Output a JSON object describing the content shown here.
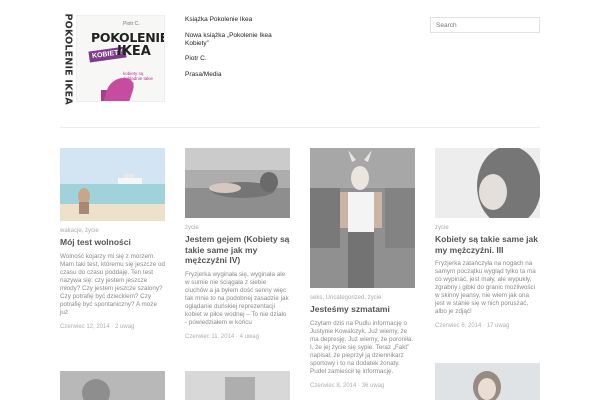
{
  "site": {
    "vertical_title": "POKOLENIE IKEA",
    "book": {
      "author": "Piotr C.",
      "title_line1": "POKOLENIE",
      "title_line2": "IKEA",
      "badge": "KOBIETY",
      "subtitle": "kobiety są dokładnie takie same"
    }
  },
  "nav": {
    "items": [
      "Książka Pokolenie Ikea",
      "Nowa książka „Pokolenie Ikea Kobiety”",
      "Piotr C.",
      "Prasa/Media"
    ]
  },
  "search": {
    "placeholder": "Search"
  },
  "posts": [
    {
      "category": "wakacje, życie",
      "title": "Mój test wolności",
      "excerpt": "Wolność kojarzy mi się z morzem. Mam taki test, któremu się jeszcze od czasu do czasu poddaję. Ten test nazywa się: czy jestem jeszcze młody? Czy jestem jeszcze szalony? Czy potrafię być dzieckiem? Czy potrafię być spontaniczny? A może już",
      "meta": "Czerwiec 12, 2014 · 2 uwag"
    },
    {
      "category": "życie",
      "title": "Jestem gejem (Kobiety są takie same jak my mężczyźni IV)",
      "excerpt": "Fryzjerka wyginała się, wyginała ale w sumie nie ściągała z siebie ciuchów a ja byłem dość senny więc tak mnie to na podobnej zasadzie jak oglądanie duńskiej reprezentacji kobiet w piłce wodnej – To nie działo - powiedziałem w końcu",
      "meta": "Czerwiec 11, 2014 · 4 uwag"
    },
    {
      "category": "seks, Uncategorized, życie",
      "title": "Jesteśmy szmatami",
      "excerpt": "Czytam dziś na Pudlu informację o Justynie Kowalczyk. Już wiemy, że ma depresję. Już wiemy, że poroniła. I, że jej życie się sypie. Teraz „Fakt” napisał, że pieprzył ją dziennikarz sportowy i to na dodatek żonaty. Pudel zamieścił tę informację.",
      "meta": "Czerwiec 8, 2014 · 36 uwag"
    },
    {
      "category": "życie",
      "title": "Kobiety są takie same jak my mężczyźni. III",
      "excerpt": "Fryzjerka zatańczyła na nogach na samym początku wygląd tylko ta ma co wypinać, jest mały, ale wypukły, zgrabny i gibki do granic możliwości w skinny jeansy, nie wiem jak ona jest w stanie się w nich poruszać, albo je zdjąć!",
      "meta": "Czerwiec 6, 2014 · 17 uwag"
    }
  ],
  "colors": {
    "accent": "#7c3d86",
    "text": "#555555",
    "muted": "#aaaaaa"
  }
}
